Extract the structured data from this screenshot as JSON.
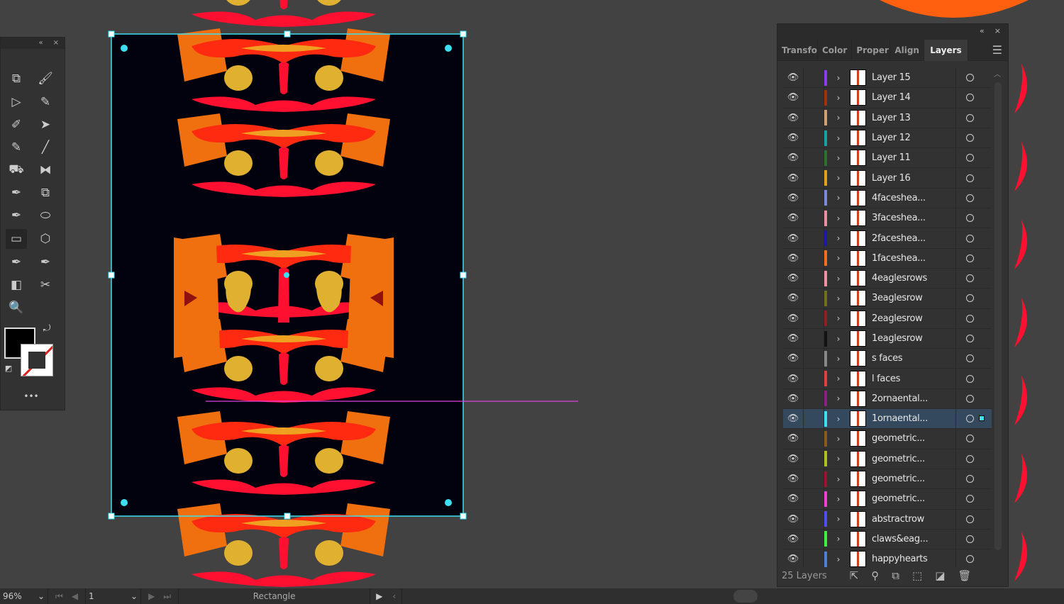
{
  "toolbar": {
    "collapse": "«",
    "close": "×",
    "more": "•••"
  },
  "panel": {
    "collapse": "«",
    "close": "×",
    "tabs": [
      "Transfo",
      "Color",
      "Proper",
      "Align",
      "Layers"
    ],
    "active_tab": "Layers",
    "layers": [
      {
        "name": "Layer 15",
        "color": "#8a3cf0"
      },
      {
        "name": "Layer 14",
        "color": "#a0330f"
      },
      {
        "name": "Layer 13",
        "color": "#d0a070"
      },
      {
        "name": "Layer 12",
        "color": "#1aa0a0"
      },
      {
        "name": "Layer 11",
        "color": "#2f6f2f"
      },
      {
        "name": "Layer 16",
        "color": "#e0a020"
      },
      {
        "name": "4faceshea...",
        "color": "#7a8ad8"
      },
      {
        "name": "3faceshea...",
        "color": "#e890a0"
      },
      {
        "name": "2faceshea...",
        "color": "#1a1aa0"
      },
      {
        "name": "1faceshea...",
        "color": "#f07020"
      },
      {
        "name": "4eaglesrows",
        "color": "#f090a0"
      },
      {
        "name": "3eaglesrow",
        "color": "#707020"
      },
      {
        "name": "2eaglesrow",
        "color": "#902020"
      },
      {
        "name": "1eaglesrow",
        "color": "#111111"
      },
      {
        "name": "s faces",
        "color": "#888888"
      },
      {
        "name": "l faces",
        "color": "#e04040"
      },
      {
        "name": "2ornaental...",
        "color": "#8a2080"
      },
      {
        "name": "1ornaental...",
        "color": "#40e0f0",
        "selected": true
      },
      {
        "name": "geometric...",
        "color": "#8a5a20"
      },
      {
        "name": "geometric...",
        "color": "#b0c020"
      },
      {
        "name": "geometric...",
        "color": "#a01030"
      },
      {
        "name": "geometric...",
        "color": "#f040d0"
      },
      {
        "name": "abstractrow",
        "color": "#5050f0"
      },
      {
        "name": "claws&eag...",
        "color": "#40f040"
      },
      {
        "name": "happyhearts",
        "color": "#5080d0"
      }
    ],
    "count_label": "25 Layers"
  },
  "status": {
    "zoom": "96%",
    "artboard": "1",
    "selection": "Rectangle"
  }
}
